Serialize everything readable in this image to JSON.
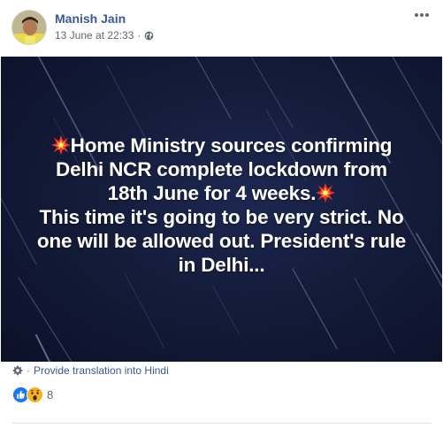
{
  "post": {
    "author": "Manish Jain",
    "timestamp": "13 June at 22:33",
    "separator": "·",
    "privacy_icon": "globe-icon",
    "menu_icon": "more-horizontal-icon"
  },
  "image": {
    "background_color": "#141c3a",
    "lines": [
      "Home Ministry sources confirming",
      "Delhi NCR complete lockdown from",
      "18th June for 4 weeks.",
      "This time it's going to be very strict. No",
      "one will be allowed out. President's rule",
      "in Delhi..."
    ],
    "emoji_icon": "collision-emoji-icon"
  },
  "translation": {
    "separator": "·",
    "link": "Provide translation into Hindi"
  },
  "reactions": {
    "icons": [
      "like-icon",
      "wow-icon"
    ],
    "count": "8"
  },
  "colors": {
    "link": "#385898",
    "meta": "#606770",
    "like": "#1877f2",
    "wow": "#f7b125"
  }
}
